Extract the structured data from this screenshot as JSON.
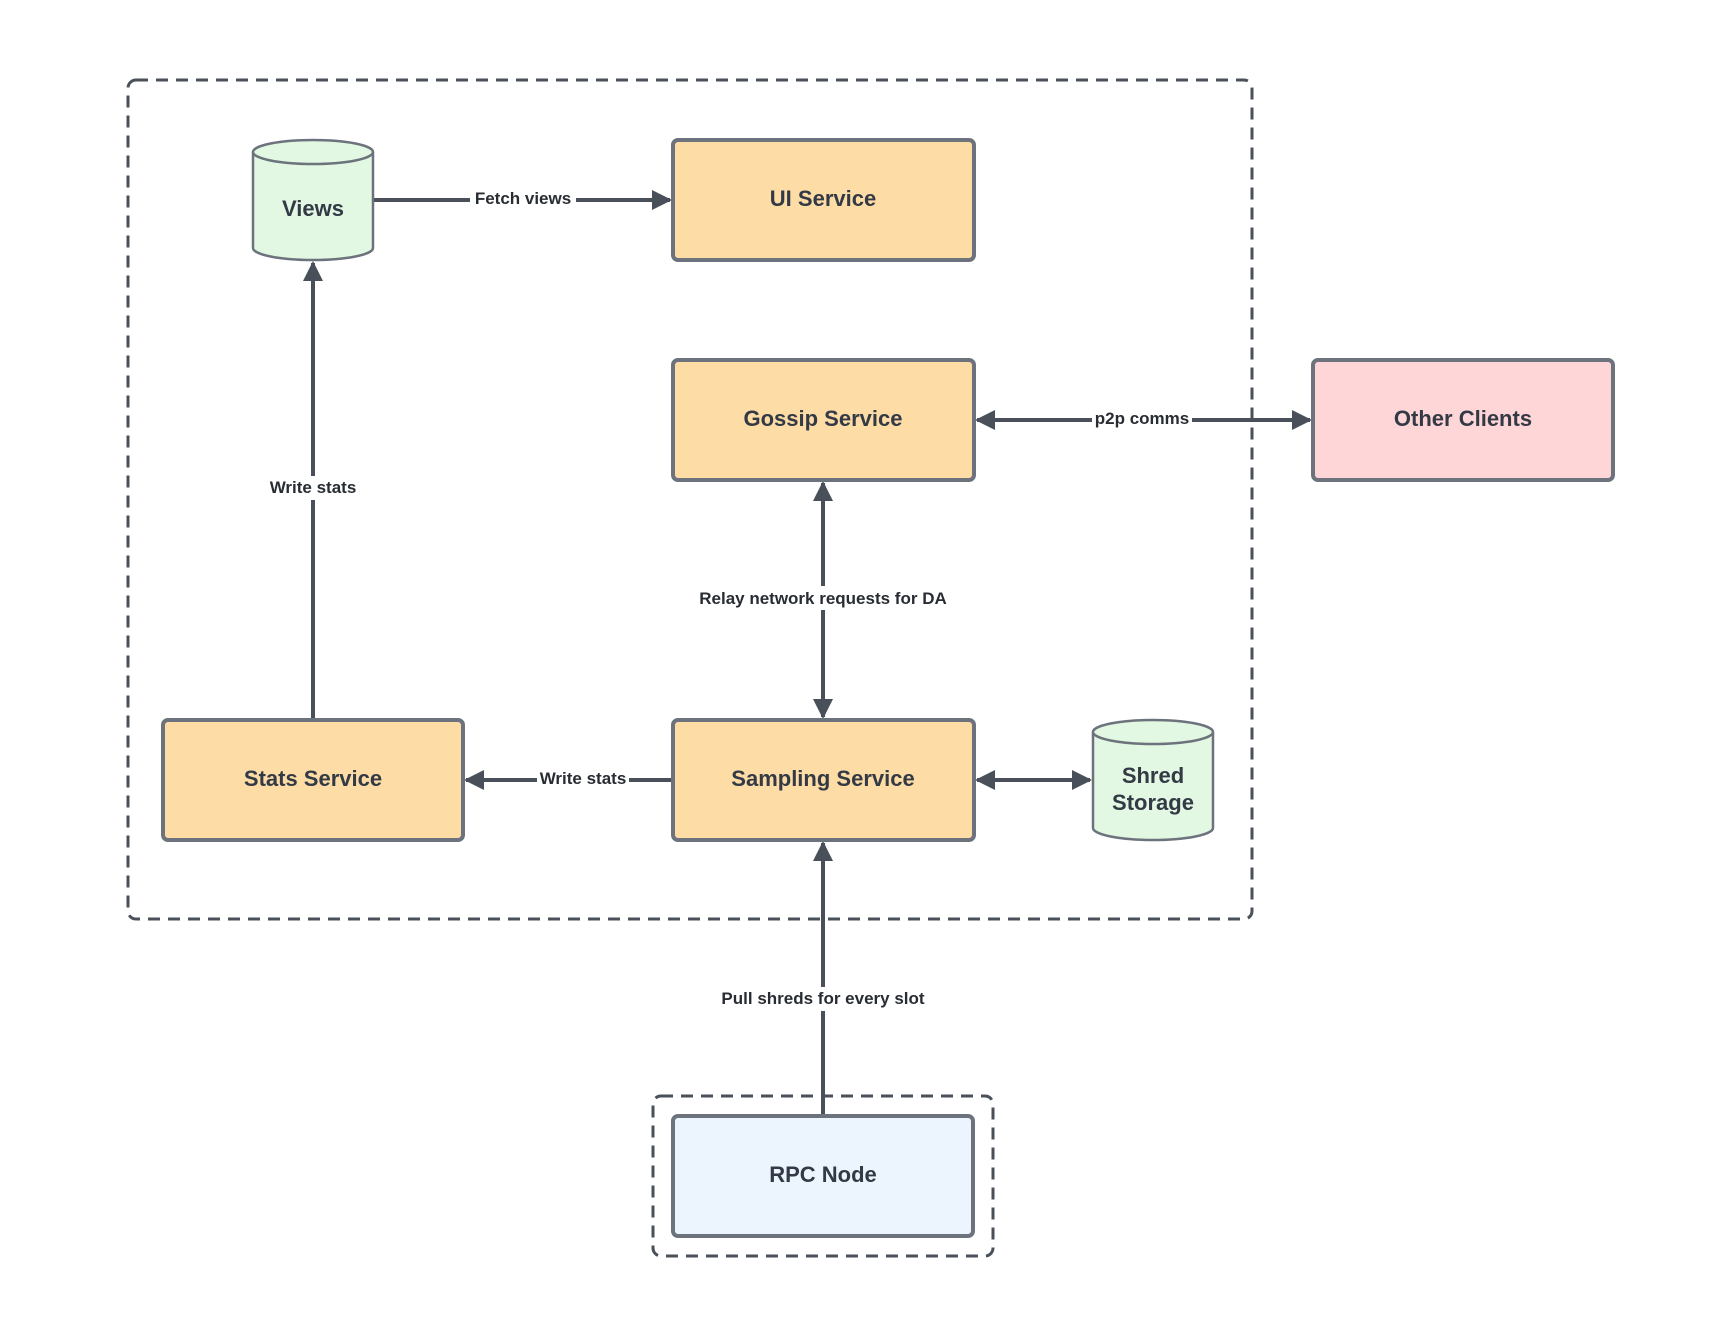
{
  "diagram": {
    "colors": {
      "service_fill": "#fddca6",
      "storage_fill": "#e2f8e2",
      "external_fill": "#ffd6d8",
      "rpc_fill": "#ecf4fe",
      "stroke": "#6c737d",
      "edge": "#4a5059",
      "text": "#333a45"
    },
    "groups": [
      {
        "id": "system-boundary",
        "style": "dashed"
      },
      {
        "id": "rpc-boundary",
        "style": "dashed"
      }
    ],
    "nodes": {
      "views": {
        "label": "Views",
        "shape": "cylinder"
      },
      "ui_service": {
        "label": "UI Service",
        "shape": "rect"
      },
      "gossip_service": {
        "label": "Gossip Service",
        "shape": "rect"
      },
      "other_clients": {
        "label": "Other Clients",
        "shape": "rect"
      },
      "stats_service": {
        "label": "Stats Service",
        "shape": "rect"
      },
      "sampling_service": {
        "label": "Sampling Service",
        "shape": "rect"
      },
      "shred_storage": {
        "label_line1": "Shred",
        "label_line2": "Storage",
        "shape": "cylinder"
      },
      "rpc_node": {
        "label": "RPC Node",
        "shape": "rect"
      }
    },
    "edges": {
      "fetch_views": {
        "from": "Views",
        "to": "UI Service",
        "label": "Fetch views",
        "direction": "forward"
      },
      "p2p_comms": {
        "from": "Gossip Service",
        "to": "Other Clients",
        "label": "p2p comms",
        "direction": "both"
      },
      "relay": {
        "from": "Gossip Service",
        "to": "Sampling Service",
        "label": "Relay network requests for DA",
        "direction": "both"
      },
      "write_stats_views": {
        "from": "Stats Service",
        "to": "Views",
        "label": "Write stats",
        "direction": "forward"
      },
      "write_stats_sampling": {
        "from": "Sampling Service",
        "to": "Stats Service",
        "label": "Write stats",
        "direction": "forward"
      },
      "shred_io": {
        "from": "Sampling Service",
        "to": "Shred Storage",
        "label": "",
        "direction": "both"
      },
      "pull_shreds": {
        "from": "RPC Node",
        "to": "Sampling Service",
        "label": "Pull shreds for every slot",
        "direction": "forward"
      }
    }
  }
}
